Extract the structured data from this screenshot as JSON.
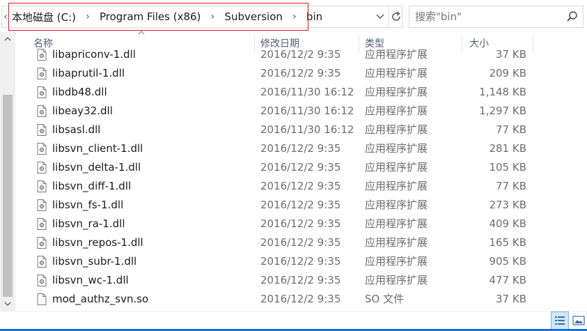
{
  "breadcrumb": {
    "items": [
      "本地磁盘 (C:)",
      "Program Files (x86)",
      "Subversion",
      "bin"
    ]
  },
  "search": {
    "placeholder": "搜索\"bin\""
  },
  "columns": {
    "name": "名称",
    "date": "修改日期",
    "type": "类型",
    "size": "大小"
  },
  "files": [
    {
      "name": "libapriconv-1.dll",
      "date": "2016/12/2 9:35",
      "type": "应用程序扩展",
      "size": "37 KB",
      "icon": "dll-file-icon"
    },
    {
      "name": "libaprutil-1.dll",
      "date": "2016/12/2 9:35",
      "type": "应用程序扩展",
      "size": "209 KB",
      "icon": "dll-file-icon"
    },
    {
      "name": "libdb48.dll",
      "date": "2016/11/30 16:12",
      "type": "应用程序扩展",
      "size": "1,148 KB",
      "icon": "dll-file-icon"
    },
    {
      "name": "libeay32.dll",
      "date": "2016/11/30 16:12",
      "type": "应用程序扩展",
      "size": "1,297 KB",
      "icon": "dll-file-icon"
    },
    {
      "name": "libsasl.dll",
      "date": "2016/11/30 16:12",
      "type": "应用程序扩展",
      "size": "77 KB",
      "icon": "dll-file-icon"
    },
    {
      "name": "libsvn_client-1.dll",
      "date": "2016/12/2 9:35",
      "type": "应用程序扩展",
      "size": "281 KB",
      "icon": "dll-file-icon"
    },
    {
      "name": "libsvn_delta-1.dll",
      "date": "2016/12/2 9:35",
      "type": "应用程序扩展",
      "size": "105 KB",
      "icon": "dll-file-icon"
    },
    {
      "name": "libsvn_diff-1.dll",
      "date": "2016/12/2 9:35",
      "type": "应用程序扩展",
      "size": "77 KB",
      "icon": "dll-file-icon"
    },
    {
      "name": "libsvn_fs-1.dll",
      "date": "2016/12/2 9:35",
      "type": "应用程序扩展",
      "size": "273 KB",
      "icon": "dll-file-icon"
    },
    {
      "name": "libsvn_ra-1.dll",
      "date": "2016/12/2 9:35",
      "type": "应用程序扩展",
      "size": "409 KB",
      "icon": "dll-file-icon"
    },
    {
      "name": "libsvn_repos-1.dll",
      "date": "2016/12/2 9:35",
      "type": "应用程序扩展",
      "size": "165 KB",
      "icon": "dll-file-icon"
    },
    {
      "name": "libsvn_subr-1.dll",
      "date": "2016/12/2 9:35",
      "type": "应用程序扩展",
      "size": "905 KB",
      "icon": "dll-file-icon"
    },
    {
      "name": "libsvn_wc-1.dll",
      "date": "2016/12/2 9:35",
      "type": "应用程序扩展",
      "size": "477 KB",
      "icon": "dll-file-icon"
    },
    {
      "name": "mod_authz_svn.so",
      "date": "2016/12/2 9:35",
      "type": "SO 文件",
      "size": "37 KB",
      "icon": "blank-file-icon"
    }
  ],
  "colors": {
    "highlight_border": "#e81123",
    "header_text": "#4c607a",
    "accent": "#1e70c8"
  }
}
